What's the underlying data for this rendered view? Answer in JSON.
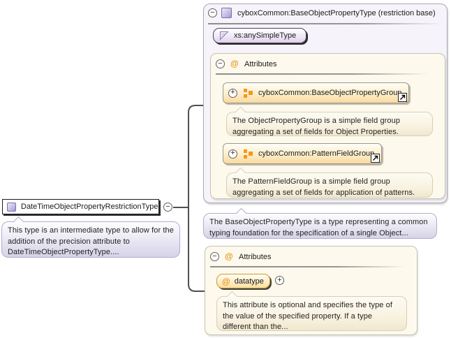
{
  "diagram": {
    "type_box": {
      "label": "DateTimeObjectPropertyRestrictionType",
      "annotation": "This type is an intermediate type to allow for the addition of the precision attribute to DateTimeObjectPropertyType...."
    },
    "base_panel": {
      "title": "cyboxCommon:BaseObjectPropertyType (restriction base)",
      "base_simple_type": "xs:anySimpleType",
      "attributes": {
        "label": "Attributes",
        "groups": [
          {
            "label": "cyboxCommon:BaseObjectPropertyGroup",
            "annotation": "The ObjectPropertyGroup is a simple field group aggregating a set of fields for Object Properties."
          },
          {
            "label": "cyboxCommon:PatternFieldGroup",
            "annotation": "The PatternFieldGroup is a simple field group aggregating a set of fields for application of patterns."
          }
        ]
      },
      "annotation": "The BaseObjectPropertyType is a type representing a common typing foundation for the specification of a single Object..."
    },
    "attributes_panel": {
      "label": "Attributes",
      "attribute": {
        "name": "datatype",
        "annotation": "This attribute is optional and specifies the type of the value of the specified property. If a type different than the..."
      }
    }
  },
  "icons": {
    "collapse_glyph": "−",
    "expand_glyph": "+",
    "attribute_glyph": "@"
  },
  "colors": {
    "accent_orange": "#f49819",
    "purple_border": "#7d6fae",
    "lavender_panel": "#f6f4fa",
    "cream_panel": "#fdf9ed",
    "connector": "#4f4f4f"
  }
}
